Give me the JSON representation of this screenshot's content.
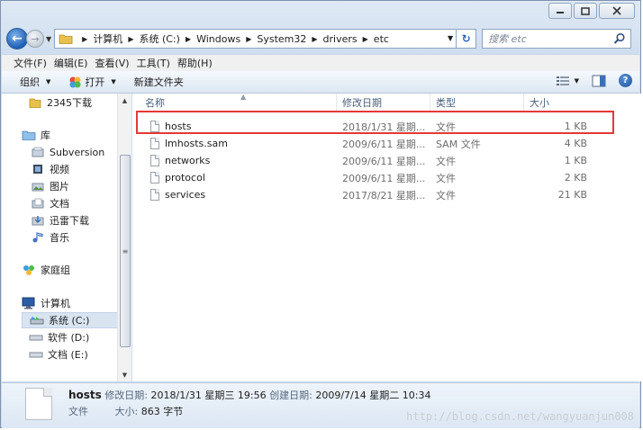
{
  "window": {
    "caption_buttons": [
      "minimize",
      "maximize",
      "close"
    ]
  },
  "navbar": {
    "breadcrumb": [
      "计算机",
      "系统 (C:)",
      "Windows",
      "System32",
      "drivers",
      "etc"
    ],
    "search_placeholder": "搜索 etc"
  },
  "menubar": {
    "items": [
      "文件(F)",
      "编辑(E)",
      "查看(V)",
      "工具(T)",
      "帮助(H)"
    ]
  },
  "commandbar": {
    "organize": "组织",
    "open": "打开",
    "new_folder": "新建文件夹"
  },
  "navpane": {
    "items": [
      {
        "label": "2345下载",
        "icon": "folder-icon"
      },
      {
        "label": "库",
        "icon": "library-icon"
      },
      {
        "label": "Subversion",
        "icon": "svn-icon"
      },
      {
        "label": "视频",
        "icon": "video-icon"
      },
      {
        "label": "图片",
        "icon": "picture-icon"
      },
      {
        "label": "文档",
        "icon": "document-icon"
      },
      {
        "label": "迅雷下载",
        "icon": "download-icon"
      },
      {
        "label": "音乐",
        "icon": "music-icon"
      },
      {
        "label": "家庭组",
        "icon": "homegroup-icon"
      },
      {
        "label": "计算机",
        "icon": "computer-icon"
      },
      {
        "label": "系统 (C:)",
        "icon": "drive-c-icon"
      },
      {
        "label": "软件 (D:)",
        "icon": "drive-icon"
      },
      {
        "label": "文档 (E:)",
        "icon": "drive-icon"
      }
    ]
  },
  "columns": {
    "name": "名称",
    "date": "修改日期",
    "type": "类型",
    "size": "大小"
  },
  "files": [
    {
      "name": "hosts",
      "date": "2018/1/31 星期...",
      "type": "文件",
      "size": "1 KB"
    },
    {
      "name": "lmhosts.sam",
      "date": "2009/6/11 星期...",
      "type": "SAM 文件",
      "size": "4 KB"
    },
    {
      "name": "networks",
      "date": "2009/6/11 星期...",
      "type": "文件",
      "size": "1 KB"
    },
    {
      "name": "protocol",
      "date": "2009/6/11 星期...",
      "type": "文件",
      "size": "2 KB"
    },
    {
      "name": "services",
      "date": "2017/8/21 星期...",
      "type": "文件",
      "size": "21 KB"
    }
  ],
  "details": {
    "name": "hosts",
    "modified_label": "修改日期:",
    "modified_value": "2018/1/31 星期三 19:56",
    "created_label": "创建日期:",
    "created_value": "2009/7/14 星期二 10:34",
    "type_value": "文件",
    "size_label": "大小:",
    "size_value": "863 字节"
  },
  "watermark": "http://blog.csdn.net/wangyuanjun008",
  "colors": {
    "highlight_border": "#e53935",
    "selection_bg": "#d9e4f1"
  }
}
